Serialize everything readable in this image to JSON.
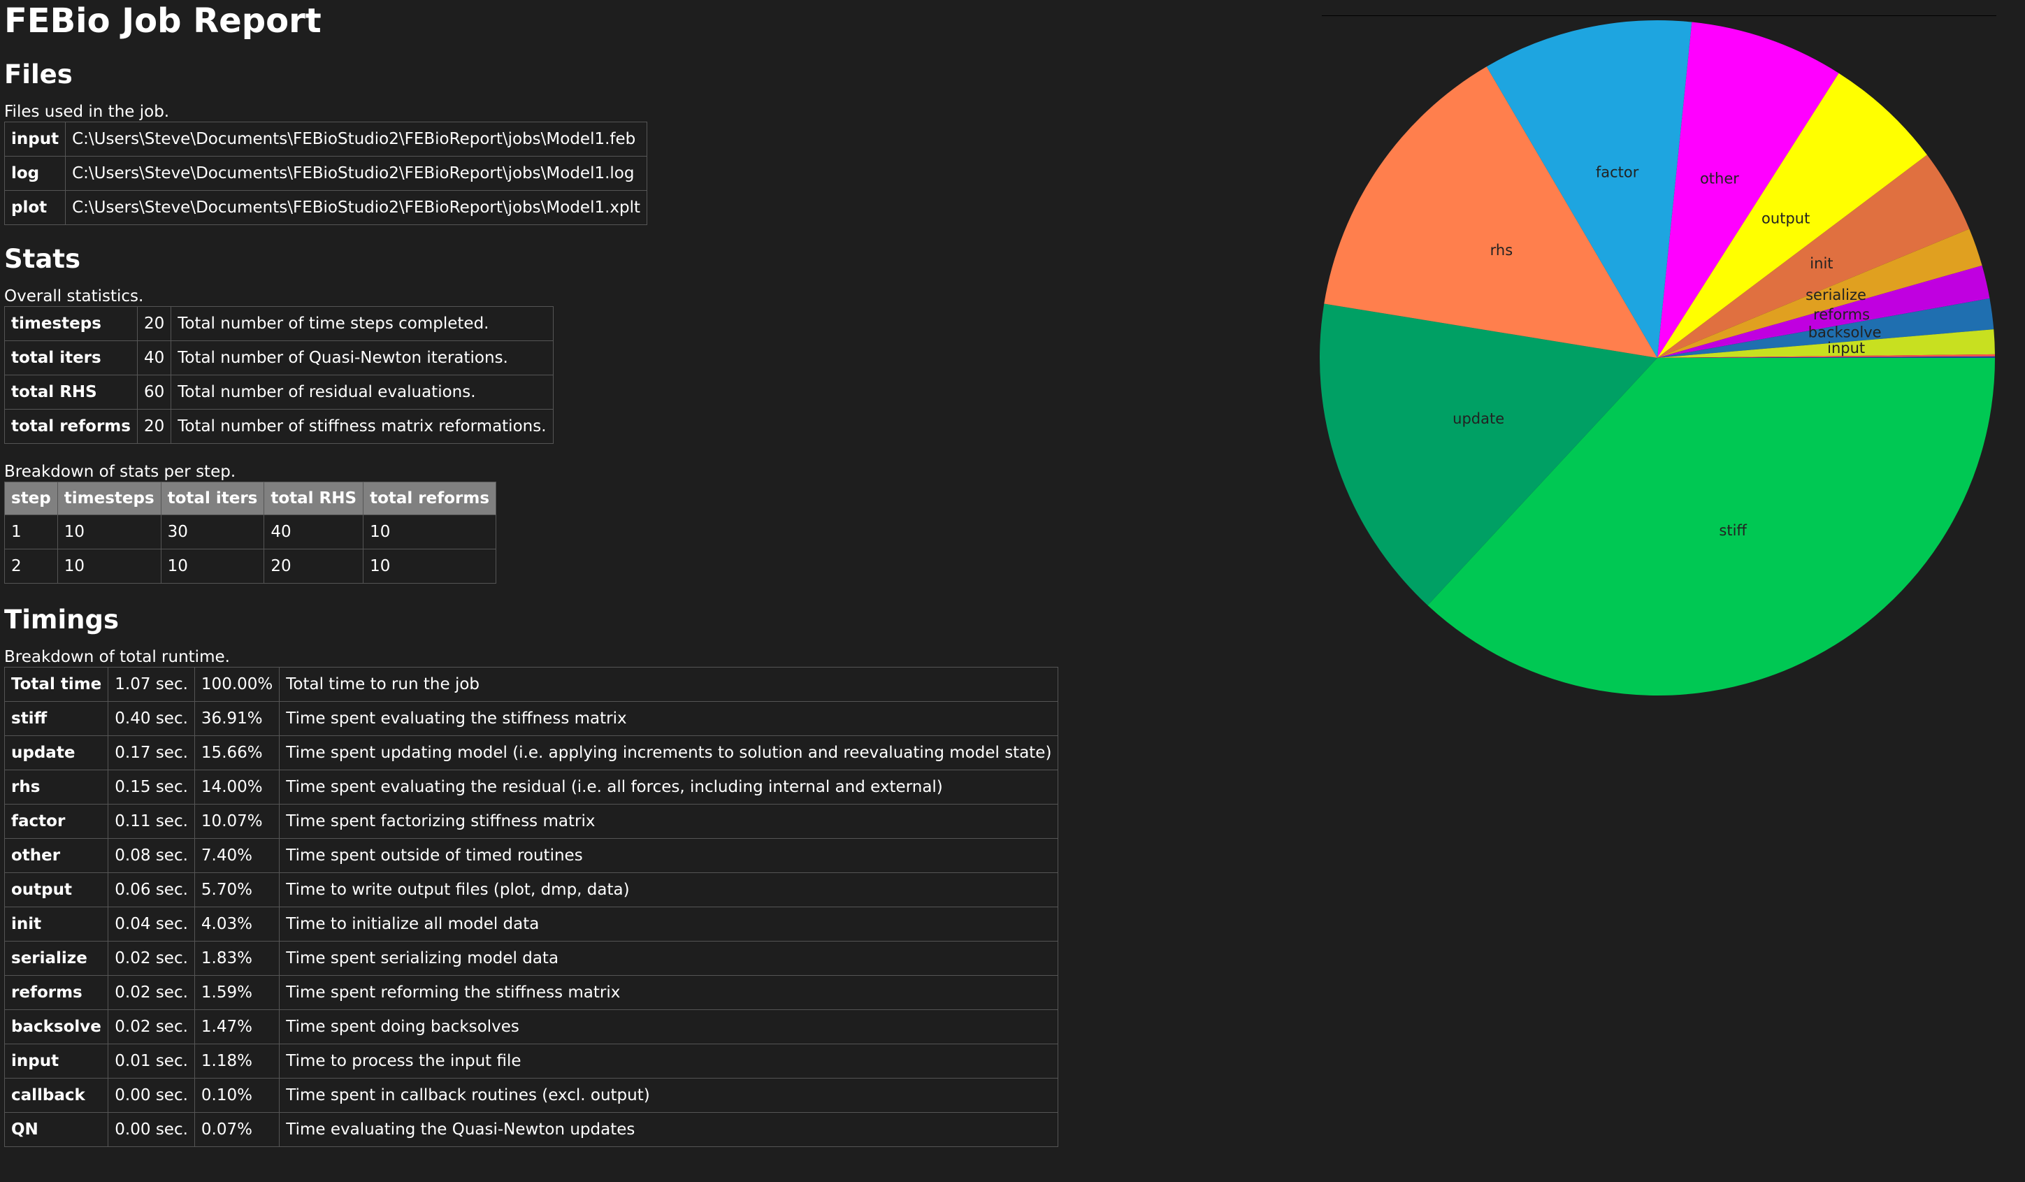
{
  "title": "FEBio Job Report",
  "files": {
    "heading": "Files",
    "description": "Files used in the job.",
    "rows": [
      {
        "key": "input",
        "value": "C:\\Users\\Steve\\Documents\\FEBioStudio2\\FEBioReport\\jobs\\Model1.feb"
      },
      {
        "key": "log",
        "value": "C:\\Users\\Steve\\Documents\\FEBioStudio2\\FEBioReport\\jobs\\Model1.log"
      },
      {
        "key": "plot",
        "value": "C:\\Users\\Steve\\Documents\\FEBioStudio2\\FEBioReport\\jobs\\Model1.xplt"
      }
    ]
  },
  "stats": {
    "heading": "Stats",
    "description": "Overall statistics.",
    "rows": [
      {
        "key": "timesteps",
        "value": "20",
        "desc": "Total number of time steps completed."
      },
      {
        "key": "total iters",
        "value": "40",
        "desc": "Total number of Quasi-Newton iterations."
      },
      {
        "key": "total RHS",
        "value": "60",
        "desc": "Total number of residual evaluations."
      },
      {
        "key": "total reforms",
        "value": "20",
        "desc": "Total number of stiffness matrix reformations."
      }
    ],
    "breakdown": {
      "description": "Breakdown of stats per step.",
      "headers": [
        "step",
        "timesteps",
        "total iters",
        "total RHS",
        "total reforms"
      ],
      "rows": [
        [
          "1",
          "10",
          "30",
          "40",
          "10"
        ],
        [
          "2",
          "10",
          "10",
          "20",
          "10"
        ]
      ]
    }
  },
  "timings": {
    "heading": "Timings",
    "description": "Breakdown of total runtime.",
    "rows": [
      {
        "key": "Total time",
        "time": "1.07 sec.",
        "pct": "100.00%",
        "desc": "Total time to run the job"
      },
      {
        "key": "stiff",
        "time": "0.40 sec.",
        "pct": "36.91%",
        "desc": "Time spent evaluating the stiffness matrix"
      },
      {
        "key": "update",
        "time": "0.17 sec.",
        "pct": "15.66%",
        "desc": "Time spent updating model (i.e. applying increments to solution and reevaluating model state)"
      },
      {
        "key": "rhs",
        "time": "0.15 sec.",
        "pct": "14.00%",
        "desc": "Time spent evaluating the residual (i.e. all forces, including internal and external)"
      },
      {
        "key": "factor",
        "time": "0.11 sec.",
        "pct": "10.07%",
        "desc": "Time spent factorizing stiffness matrix"
      },
      {
        "key": "other",
        "time": "0.08 sec.",
        "pct": "7.40%",
        "desc": "Time spent outside of timed routines"
      },
      {
        "key": "output",
        "time": "0.06 sec.",
        "pct": "5.70%",
        "desc": "Time to write output files (plot, dmp, data)"
      },
      {
        "key": "init",
        "time": "0.04 sec.",
        "pct": "4.03%",
        "desc": "Time to initialize all model data"
      },
      {
        "key": "serialize",
        "time": "0.02 sec.",
        "pct": "1.83%",
        "desc": "Time spent serializing model data"
      },
      {
        "key": "reforms",
        "time": "0.02 sec.",
        "pct": "1.59%",
        "desc": "Time spent reforming the stiffness matrix"
      },
      {
        "key": "backsolve",
        "time": "0.02 sec.",
        "pct": "1.47%",
        "desc": "Time spent doing backsolves"
      },
      {
        "key": "input",
        "time": "0.01 sec.",
        "pct": "1.18%",
        "desc": "Time to process the input file"
      },
      {
        "key": "callback",
        "time": "0.00 sec.",
        "pct": "0.10%",
        "desc": "Time spent in callback routines (excl. output)"
      },
      {
        "key": "QN",
        "time": "0.00 sec.",
        "pct": "0.07%",
        "desc": "Time evaluating the Quasi-Newton updates"
      }
    ]
  },
  "chart_data": {
    "type": "pie",
    "title": "",
    "slices": [
      {
        "label": "stiff",
        "value": 36.91,
        "color": "#00c853"
      },
      {
        "label": "update",
        "value": 15.66,
        "color": "#00a064"
      },
      {
        "label": "rhs",
        "value": 14.0,
        "color": "#ff7f4d"
      },
      {
        "label": "factor",
        "value": 10.07,
        "color": "#1ea5e0"
      },
      {
        "label": "other",
        "value": 7.4,
        "color": "#ff00ff"
      },
      {
        "label": "output",
        "value": 5.7,
        "color": "#ffff00"
      },
      {
        "label": "init",
        "value": 4.03,
        "color": "#e07040"
      },
      {
        "label": "serialize",
        "value": 1.83,
        "color": "#e0a020"
      },
      {
        "label": "reforms",
        "value": 1.59,
        "color": "#c000e0"
      },
      {
        "label": "backsolve",
        "value": 1.47,
        "color": "#1f6fb0"
      },
      {
        "label": "input",
        "value": 1.18,
        "color": "#c8e020"
      },
      {
        "label": "callback",
        "value": 0.1,
        "color": "#ff5050"
      },
      {
        "label": "QN",
        "value": 0.07,
        "color": "#2040a0"
      }
    ]
  }
}
